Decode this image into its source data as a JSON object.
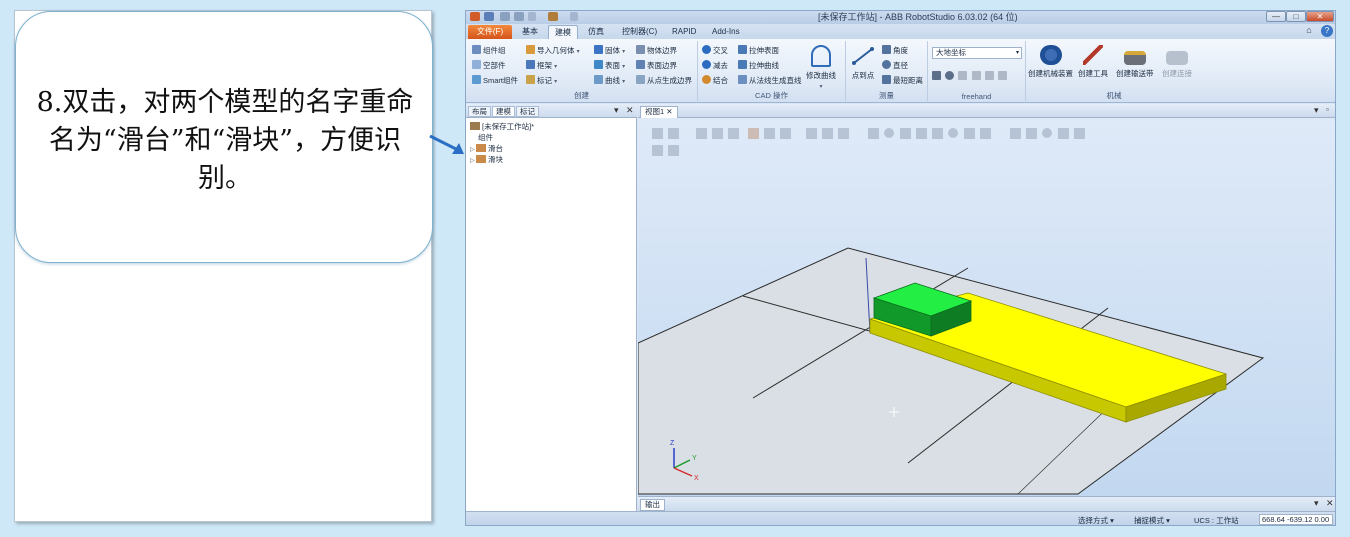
{
  "instruction": {
    "step_text": "8.双击，对两个模型的名字重命名为“滑台”和“滑块”，方便识别。"
  },
  "window": {
    "title": "[未保存工作站] - ABB RobotStudio 6.03.02 (64 位)",
    "minimize": "—",
    "maximize": "□",
    "close": "✕"
  },
  "ribbon_tabs": [
    "文件(F)",
    "基本",
    "建模",
    "仿真",
    "控制器(C)",
    "RAPID",
    "Add-Ins"
  ],
  "ribbon": {
    "create": {
      "label": "创建",
      "items": [
        "组件组",
        "空部件",
        "Smart组件",
        "导入几何体",
        "框架",
        "标记"
      ]
    },
    "cad": {
      "label": "CAD 操作",
      "items": [
        "固体",
        "表面",
        "曲线",
        "物体边界",
        "表面边界",
        "从点生成边界",
        "交叉",
        "减去",
        "结合",
        "拉伸表面",
        "拉伸曲线",
        "从法线生成直线"
      ],
      "big_button": "修改曲线"
    },
    "measure": {
      "label": "测量",
      "big_button": "点到点",
      "items": [
        "角度",
        "直径",
        "最短距离"
      ]
    },
    "freehand": {
      "label": "freehand",
      "coordinate_system": "大地坐标"
    },
    "mechanism": {
      "label": "机械",
      "buttons": [
        "创建机械装置",
        "创建工具",
        "创建输送带",
        "创建连接"
      ]
    }
  },
  "left_pane": {
    "tabs": [
      "布局",
      "建模",
      "标记"
    ],
    "tree": {
      "station": "[未保存工作站]*",
      "group": "组件",
      "items": [
        "滑台",
        "滑块"
      ]
    }
  },
  "viewport": {
    "tab_label": "视图1",
    "close": "✕"
  },
  "output": {
    "tab_label": "输出"
  },
  "status": {
    "selection_mode": "选择方式 ▾",
    "snap_mode": "捕捉模式 ▾",
    "ucs": "UCS : 工作站",
    "coords": "668.64  -639.12  0.00"
  },
  "axis": {
    "x": "X",
    "y": "Y",
    "z": "Z"
  },
  "colors": {
    "slider_top": "#ffff00",
    "slider_side": "#c8c800",
    "block_top": "#22ee44",
    "block_side": "#119a2a",
    "file_tab": "#e46a25",
    "floor": "#d9dfe4"
  },
  "pane_controls": {
    "pin": "▾",
    "close": "✕"
  }
}
